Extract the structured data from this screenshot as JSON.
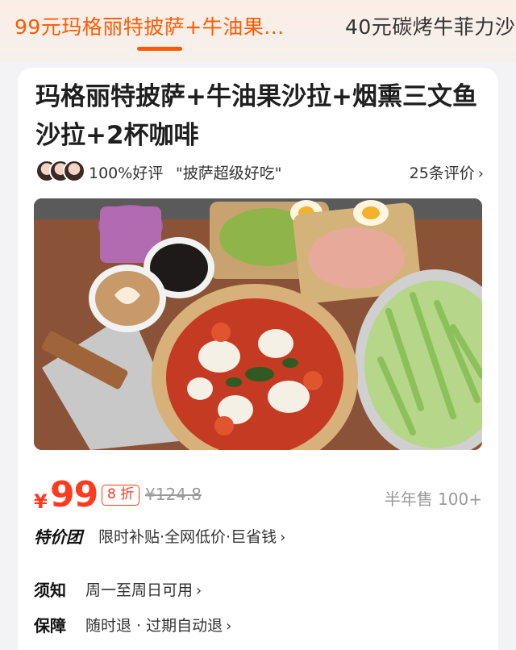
{
  "tabs": [
    {
      "label": "99元玛格丽特披萨+牛油果...",
      "active": true
    },
    {
      "label": "40元碳烤牛菲力沙",
      "active": false
    }
  ],
  "product": {
    "title": "玛格丽特披萨+牛油果沙拉+烟熏三文鱼沙拉+2杯咖啡",
    "rating_text": "100%好评",
    "review_quote": "\"披萨超级好吃\"",
    "review_count": "25条评价",
    "photo_description": "pizza, salads, coffee and cucumbers on wooden table"
  },
  "price": {
    "currency": "¥",
    "amount": "99",
    "discount_badge": "8 折",
    "original": "¥124.8",
    "sold": "半年售 100+"
  },
  "promo": {
    "brand": "特价团",
    "text": "限时补贴·全网低价·巨省钱"
  },
  "notice": {
    "label": "须知",
    "text": "周一至周日可用"
  },
  "guarantee": {
    "label": "保障",
    "text": "随时退 · 过期自动退"
  },
  "colors": {
    "accent": "#ff5a00",
    "price": "#ff3b1f"
  },
  "icons": [
    "chevron-right-icon"
  ]
}
